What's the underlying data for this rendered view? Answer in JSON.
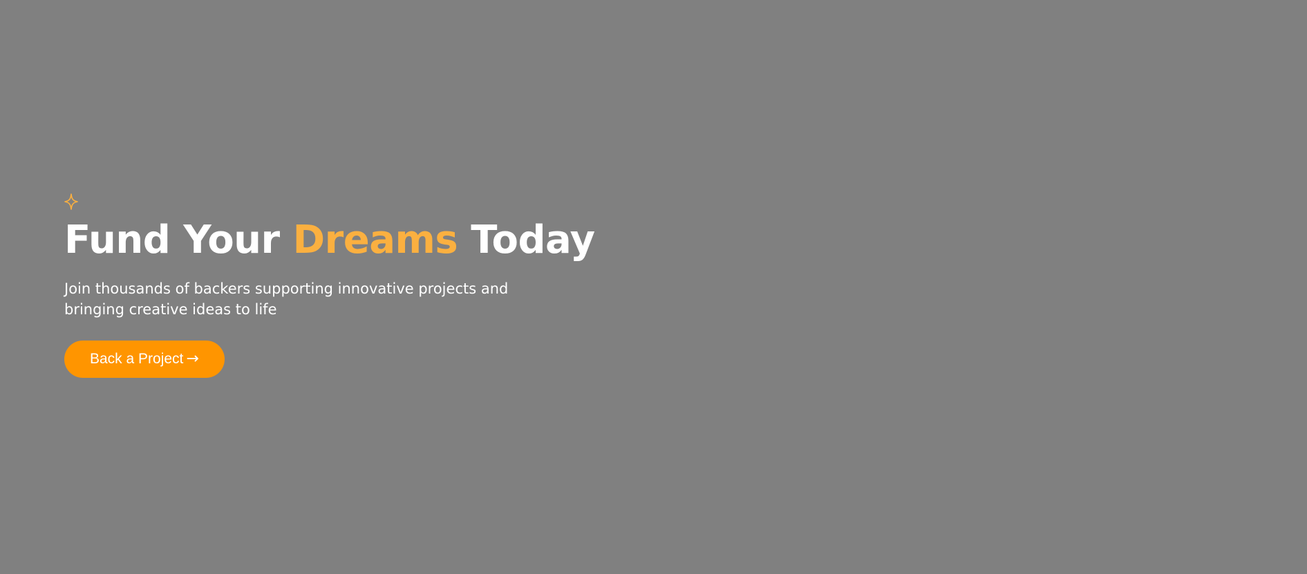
{
  "hero": {
    "icon": "sparkle-icon",
    "title_part1": "Fund Your ",
    "title_accent": "Dreams",
    "title_part2": " Today",
    "subtitle": "Join thousands of backers supporting innovative projects and bringing creative ideas to life",
    "cta_label": "Back a Project",
    "cta_arrow": "→"
  },
  "colors": {
    "background": "#808080",
    "accent": "#fbb040",
    "button": "#ff9500",
    "text": "#ffffff"
  }
}
